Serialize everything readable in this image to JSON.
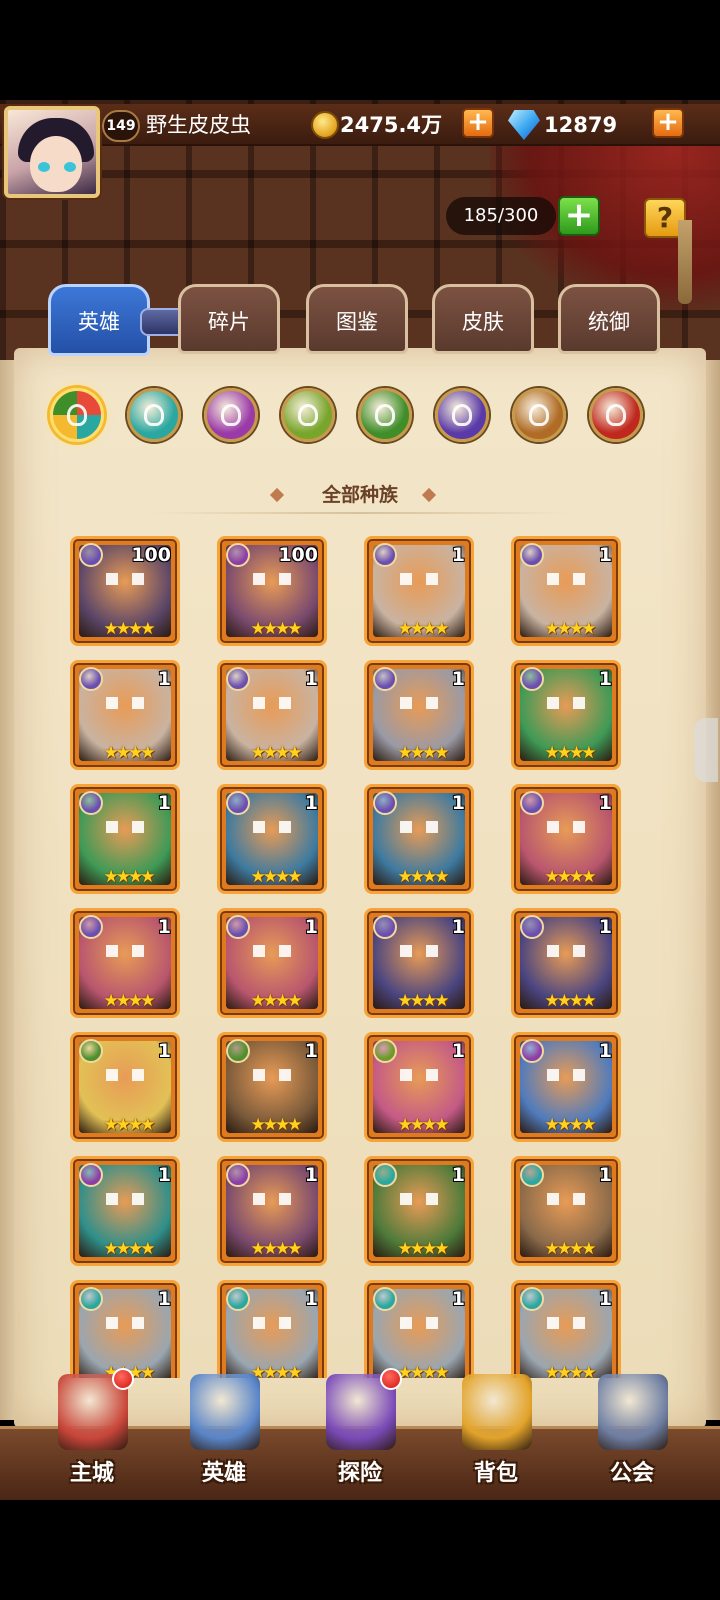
{
  "player": {
    "level": "149",
    "name": "野生皮皮虫",
    "gold": "2475.4万",
    "diamonds": "12879"
  },
  "roster": {
    "capacity": "185/300",
    "help_label": "?"
  },
  "tabs": [
    {
      "label": "英雄",
      "active": true
    },
    {
      "label": "碎片",
      "active": false
    },
    {
      "label": "图鉴",
      "active": false
    },
    {
      "label": "皮肤",
      "active": false
    },
    {
      "label": "统御",
      "active": false
    }
  ],
  "race_filter": {
    "title": "全部种族",
    "races": [
      {
        "icon": "all-races-icon",
        "color": "#e84a3a",
        "selected": true
      },
      {
        "icon": "shadow-race-icon",
        "color": "#2aa7a0",
        "selected": false
      },
      {
        "icon": "fortress-race-icon",
        "color": "#9a3aa8",
        "selected": false
      },
      {
        "icon": "abyss-race-icon",
        "color": "#78a52c",
        "selected": false
      },
      {
        "icon": "forest-race-icon",
        "color": "#3f8e2a",
        "selected": false
      },
      {
        "icon": "dark-race-icon",
        "color": "#5a3aa8",
        "selected": false
      },
      {
        "icon": "light-race-icon",
        "color": "#b06b26",
        "selected": false
      },
      {
        "icon": "hell-race-icon",
        "color": "#c0281e",
        "selected": false
      }
    ]
  },
  "heroes": [
    {
      "count": "100",
      "stars": "★★★★",
      "faction_color": "#6a4fb0",
      "art_color": "#5b4668"
    },
    {
      "count": "100",
      "stars": "★★★★",
      "faction_color": "#8b3fa6",
      "art_color": "#7a4a6e"
    },
    {
      "count": "1",
      "stars": "★★★★",
      "faction_color": "#6a4fb0",
      "art_color": "#c9b3a1"
    },
    {
      "count": "1",
      "stars": "★★★★",
      "faction_color": "#6a4fb0",
      "art_color": "#c9b3a1"
    },
    {
      "count": "1",
      "stars": "★★★★",
      "faction_color": "#6a4fb0",
      "art_color": "#c9b3a1"
    },
    {
      "count": "1",
      "stars": "★★★★",
      "faction_color": "#6a4fb0",
      "art_color": "#c9b3a1"
    },
    {
      "count": "1",
      "stars": "★★★★",
      "faction_color": "#6a4fb0",
      "art_color": "#9a9aa5"
    },
    {
      "count": "1",
      "stars": "★★★★",
      "faction_color": "#6a4fb0",
      "art_color": "#3e9a56"
    },
    {
      "count": "1",
      "stars": "★★★★",
      "faction_color": "#6a4fb0",
      "art_color": "#3e9a56"
    },
    {
      "count": "1",
      "stars": "★★★★",
      "faction_color": "#6a4fb0",
      "art_color": "#3d7aa0"
    },
    {
      "count": "1",
      "stars": "★★★★",
      "faction_color": "#6a4fb0",
      "art_color": "#3d7aa0"
    },
    {
      "count": "1",
      "stars": "★★★★",
      "faction_color": "#6a4fb0",
      "art_color": "#b8566e"
    },
    {
      "count": "1",
      "stars": "★★★★",
      "faction_color": "#6a4fb0",
      "art_color": "#b8566e"
    },
    {
      "count": "1",
      "stars": "★★★★",
      "faction_color": "#6a4fb0",
      "art_color": "#b8566e"
    },
    {
      "count": "1",
      "stars": "★★★★",
      "faction_color": "#6a4fb0",
      "art_color": "#4a4580"
    },
    {
      "count": "1",
      "stars": "★★★★",
      "faction_color": "#6a4fb0",
      "art_color": "#4a4580"
    },
    {
      "count": "1",
      "stars": "★★★★",
      "faction_color": "#4f8f2e",
      "art_color": "#e2c156"
    },
    {
      "count": "1",
      "stars": "★★★★",
      "faction_color": "#4f8f2e",
      "art_color": "#7a5a3a"
    },
    {
      "count": "1",
      "stars": "★★★★",
      "faction_color": "#6e9a2a",
      "art_color": "#c45a86"
    },
    {
      "count": "1",
      "stars": "★★★★",
      "faction_color": "#8b3fa6",
      "art_color": "#4f7bbd"
    },
    {
      "count": "1",
      "stars": "★★★★",
      "faction_color": "#8b3fa6",
      "art_color": "#2f8f8a"
    },
    {
      "count": "1",
      "stars": "★★★★",
      "faction_color": "#8b3fa6",
      "art_color": "#7a4a6e"
    },
    {
      "count": "1",
      "stars": "★★★★",
      "faction_color": "#2aa7a0",
      "art_color": "#4d7a3a"
    },
    {
      "count": "1",
      "stars": "★★★★",
      "faction_color": "#2aa7a0",
      "art_color": "#8a6a4a"
    },
    {
      "count": "1",
      "stars": "★★★★",
      "faction_color": "#2aa7a0",
      "art_color": "#9aa6b0"
    },
    {
      "count": "1",
      "stars": "★★★★",
      "faction_color": "#2aa7a0",
      "art_color": "#9aa6b0"
    },
    {
      "count": "1",
      "stars": "★★★★",
      "faction_color": "#2aa7a0",
      "art_color": "#9aa6b0"
    },
    {
      "count": "1",
      "stars": "★★★★",
      "faction_color": "#2aa7a0",
      "art_color": "#9aa6b0"
    }
  ],
  "bottom_nav": [
    {
      "label": "主城",
      "icon": "castle-icon",
      "color": "#c9463a",
      "badge": true
    },
    {
      "label": "英雄",
      "icon": "hero-icon",
      "color": "#5a86c9",
      "badge": false
    },
    {
      "label": "探险",
      "icon": "portal-icon",
      "color": "#7a4ab8",
      "badge": true
    },
    {
      "label": "背包",
      "icon": "backpack-icon",
      "color": "#e2a32a",
      "badge": false
    },
    {
      "label": "公会",
      "icon": "guild-tower-icon",
      "color": "#6f7fa3",
      "badge": false
    }
  ]
}
